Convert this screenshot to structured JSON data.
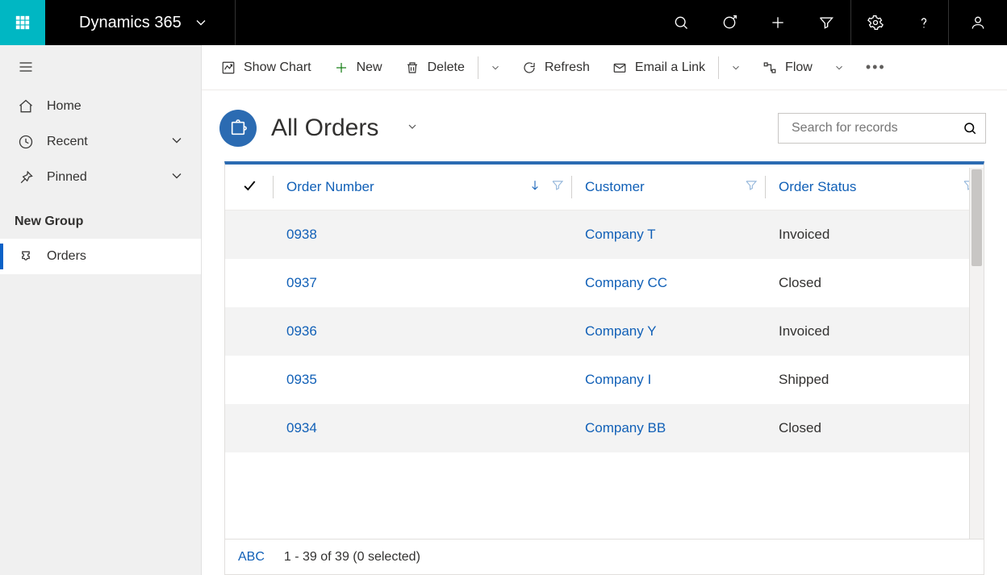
{
  "topbar": {
    "brand": "Dynamics 365"
  },
  "nav": {
    "home": "Home",
    "recent": "Recent",
    "pinned": "Pinned",
    "group_label": "New Group",
    "orders": "Orders"
  },
  "cmdbar": {
    "show_chart": "Show Chart",
    "new": "New",
    "delete": "Delete",
    "refresh": "Refresh",
    "email_link": "Email a Link",
    "flow": "Flow"
  },
  "view": {
    "title": "All Orders",
    "search_placeholder": "Search for records"
  },
  "grid": {
    "columns": {
      "order_number": "Order Number",
      "customer": "Customer",
      "order_status": "Order Status"
    },
    "rows": [
      {
        "number": "0938",
        "customer": "Company T",
        "status": "Invoiced"
      },
      {
        "number": "0937",
        "customer": "Company CC",
        "status": "Closed"
      },
      {
        "number": "0936",
        "customer": "Company Y",
        "status": "Invoiced"
      },
      {
        "number": "0935",
        "customer": "Company I",
        "status": "Shipped"
      },
      {
        "number": "0934",
        "customer": "Company BB",
        "status": "Closed"
      }
    ]
  },
  "footer": {
    "abc": "ABC",
    "count": "1 - 39 of 39 (0 selected)"
  }
}
